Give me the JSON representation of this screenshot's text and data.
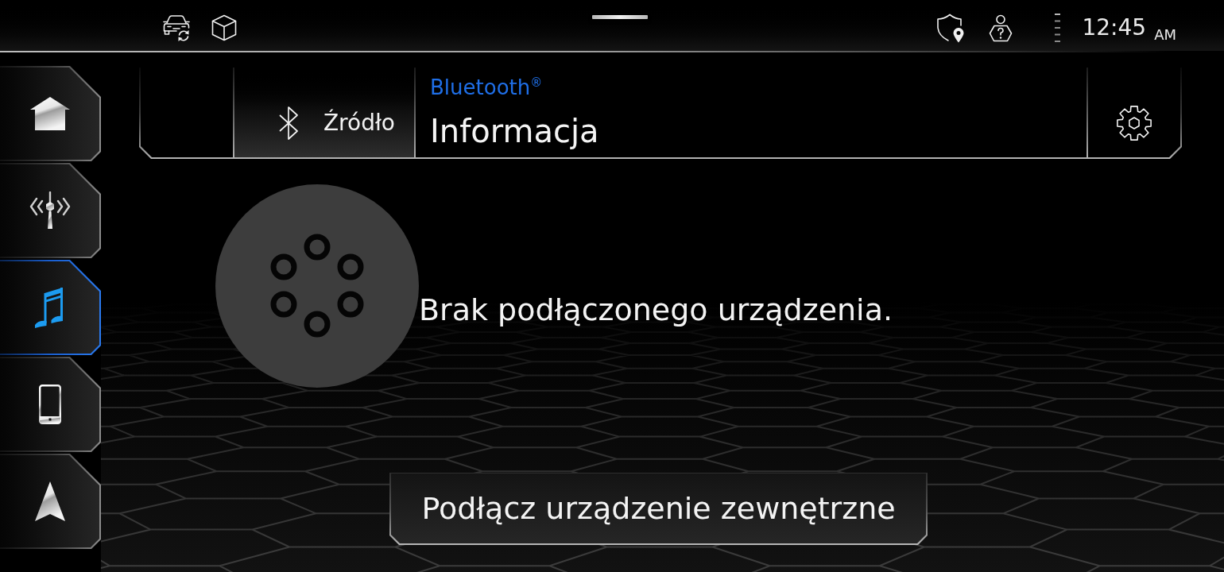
{
  "status_bar": {
    "time": "12:45",
    "period": "AM"
  },
  "sidebar": {
    "items": [
      {
        "selected": false
      },
      {
        "selected": false
      },
      {
        "selected": true
      },
      {
        "selected": false
      },
      {
        "selected": false
      }
    ]
  },
  "header": {
    "source_button": {
      "label": "Źródło"
    },
    "source": "Bluetooth$^{®}$",
    "title": "Informacja"
  },
  "content": {
    "message": "Brak podłączonego urządzenia.",
    "button": {
      "label": "Podłącz urządzenie zewnętrzne"
    }
  }
}
